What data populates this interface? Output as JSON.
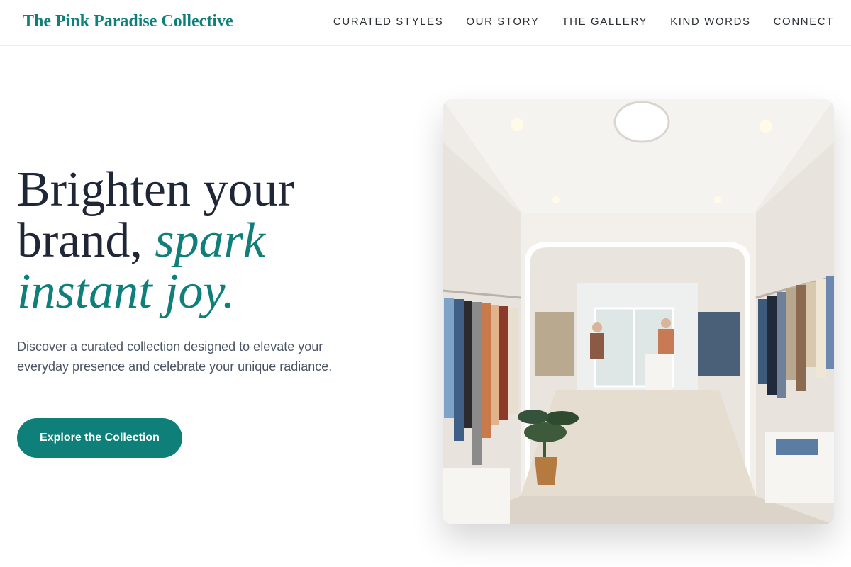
{
  "brand": {
    "name": "The Pink Paradise Collective"
  },
  "nav": {
    "items": [
      {
        "label": "CURATED STYLES"
      },
      {
        "label": "OUR STORY"
      },
      {
        "label": "THE GALLERY"
      },
      {
        "label": "KIND WORDS"
      },
      {
        "label": "CONNECT"
      }
    ]
  },
  "hero": {
    "title_line1": "Brighten your",
    "title_line2": "brand, ",
    "title_accent1": "spark",
    "title_accent2": "instant joy.",
    "description": "Discover a curated collection designed to elevate your everyday presence and celebrate your unique radiance.",
    "cta_label": "Explore the Collection",
    "image_subject": "clothing-boutique-interior"
  },
  "colors": {
    "accent": "#0f7f7a",
    "heading": "#1e2638",
    "body_text": "#4b5563"
  }
}
